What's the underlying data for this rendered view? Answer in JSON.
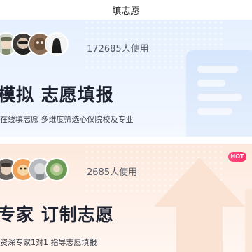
{
  "page": {
    "title": "填志愿"
  },
  "cards": [
    {
      "users_count": "172685人使用",
      "headline": "模拟 志愿填报",
      "subline": "在线填志愿 多维度筛选心仪院校及专业"
    },
    {
      "badge": "HOT",
      "users_count": "2685人使用",
      "headline": "专家 订制志愿",
      "subline": "资深专家1对1 指导志愿填报"
    }
  ],
  "colors": {
    "card1_bg": "#e6f0fe",
    "card2_bg": "#fde9dd",
    "hot_badge": "#ff3d74",
    "headline_text": "#1e2230"
  }
}
